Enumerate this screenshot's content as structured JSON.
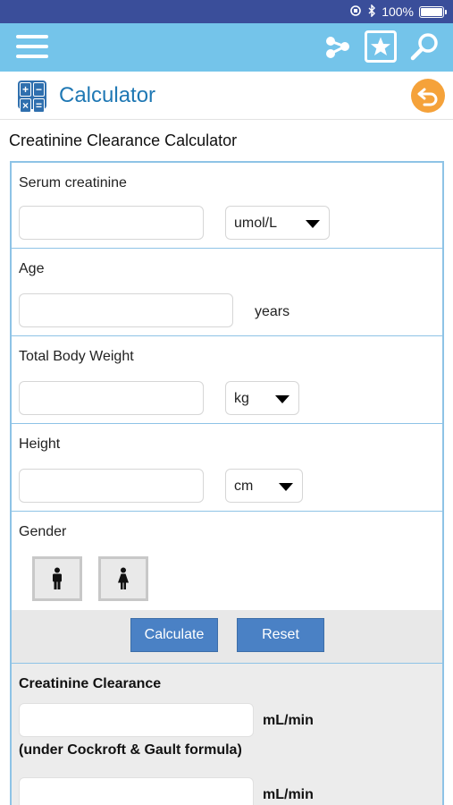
{
  "status_bar": {
    "battery_percent": "100%",
    "icons": [
      "orientation-lock-icon",
      "bluetooth-icon",
      "battery-icon"
    ]
  },
  "app_bar": {
    "icons": [
      "menu-icon",
      "share-icon",
      "bookmark-star-icon",
      "search-icon"
    ],
    "color": "#74c4ea"
  },
  "title_bar": {
    "title": "Calculator",
    "calc_keys": [
      "+",
      "−",
      "×",
      "="
    ]
  },
  "page": {
    "heading": "Creatinine Clearance Calculator"
  },
  "form": {
    "serum_creatinine": {
      "label": "Serum creatinine",
      "value": "",
      "unit_selected": "umol/L"
    },
    "age": {
      "label": "Age",
      "value": "",
      "unit": "years"
    },
    "weight": {
      "label": "Total Body Weight",
      "value": "",
      "unit_selected": "kg"
    },
    "height": {
      "label": "Height",
      "value": "",
      "unit_selected": "cm"
    },
    "gender": {
      "label": "Gender",
      "options": [
        "male-icon",
        "female-icon"
      ]
    }
  },
  "actions": {
    "calculate": "Calculate",
    "reset": "Reset"
  },
  "result": {
    "heading": "Creatinine Clearance",
    "value_1": "",
    "unit_1": "mL/min",
    "formula_1": "(under Cockroft & Gault formula)",
    "value_2": "",
    "unit_2": "mL/min"
  },
  "colors": {
    "status_bar": "#3a4e9a",
    "accent_blue": "#1f78b4",
    "button": "#4a81c5",
    "back_orange": "#f5a23a",
    "border": "#8ec3e6"
  }
}
